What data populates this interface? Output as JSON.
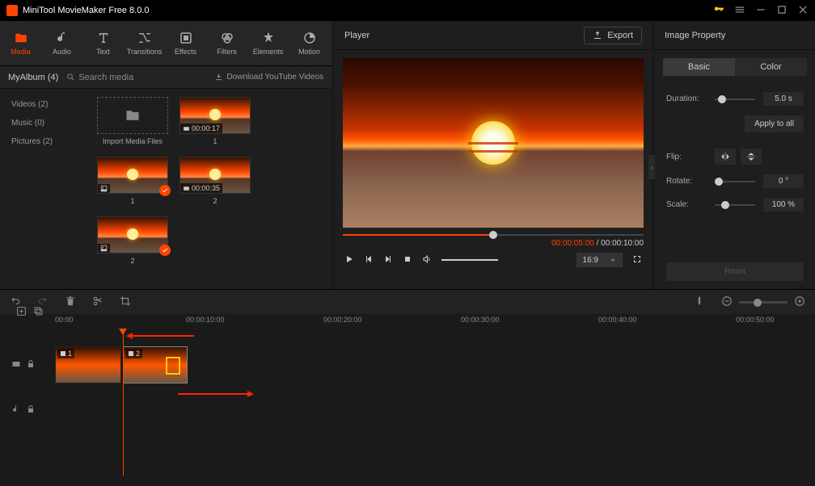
{
  "app": {
    "title": "MiniTool MovieMaker Free 8.0.0"
  },
  "ribbon": [
    {
      "label": "Media",
      "icon": "folder",
      "active": true
    },
    {
      "label": "Audio",
      "icon": "music"
    },
    {
      "label": "Text",
      "icon": "text"
    },
    {
      "label": "Transitions",
      "icon": "transition"
    },
    {
      "label": "Effects",
      "icon": "effects"
    },
    {
      "label": "Filters",
      "icon": "filters"
    },
    {
      "label": "Elements",
      "icon": "elements"
    },
    {
      "label": "Motion",
      "icon": "motion"
    }
  ],
  "media": {
    "album": "MyAlbum (4)",
    "search_placeholder": "Search media",
    "download_label": "Download YouTube Videos",
    "sidebar": [
      {
        "label": "Videos (2)"
      },
      {
        "label": "Music (0)"
      },
      {
        "label": "Pictures (2)"
      }
    ],
    "tiles": [
      {
        "type": "import",
        "label": "Import Media Files"
      },
      {
        "type": "video",
        "duration": "00:00:17",
        "label": "1"
      },
      {
        "type": "image",
        "label": "1",
        "checked": true
      },
      {
        "type": "video",
        "duration": "00:00:35",
        "label": "2"
      },
      {
        "type": "image",
        "label": "2",
        "checked": true
      }
    ]
  },
  "player": {
    "title": "Player",
    "export_label": "Export",
    "current_time": "00:00:05:00",
    "total_time": "00:00:10:00",
    "aspect": "16:9"
  },
  "props": {
    "title": "Image Property",
    "tabs": {
      "basic": "Basic",
      "color": "Color"
    },
    "duration": {
      "label": "Duration:",
      "value": "5.0 s"
    },
    "apply_all": "Apply to all",
    "flip": {
      "label": "Flip:"
    },
    "rotate": {
      "label": "Rotate:",
      "value": "0 °"
    },
    "scale": {
      "label": "Scale:",
      "value": "100 %"
    },
    "reset": "Reset"
  },
  "timeline": {
    "marks": [
      "00:00",
      "00:00:10:00",
      "00:00:20:00",
      "00:00:30:00",
      "00:00:40:00",
      "00:00:50:00"
    ],
    "clips": [
      {
        "idx": "1"
      },
      {
        "idx": "2"
      }
    ]
  }
}
